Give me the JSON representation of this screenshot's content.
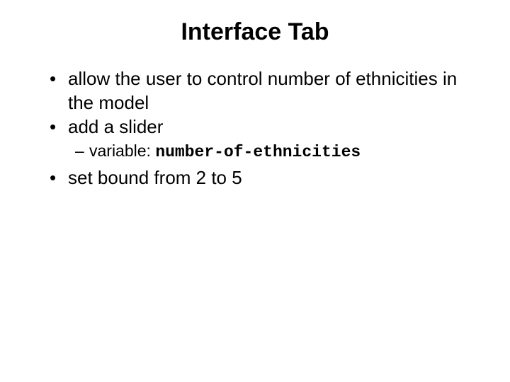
{
  "title": "Interface  Tab",
  "bullets": {
    "b1": "allow the user to control number of ethnicities in the model",
    "b2": "add a slider",
    "b2_sub_label": "variable: ",
    "b2_sub_code": "number-of-ethnicities",
    "b3": "set bound from 2 to 5"
  }
}
